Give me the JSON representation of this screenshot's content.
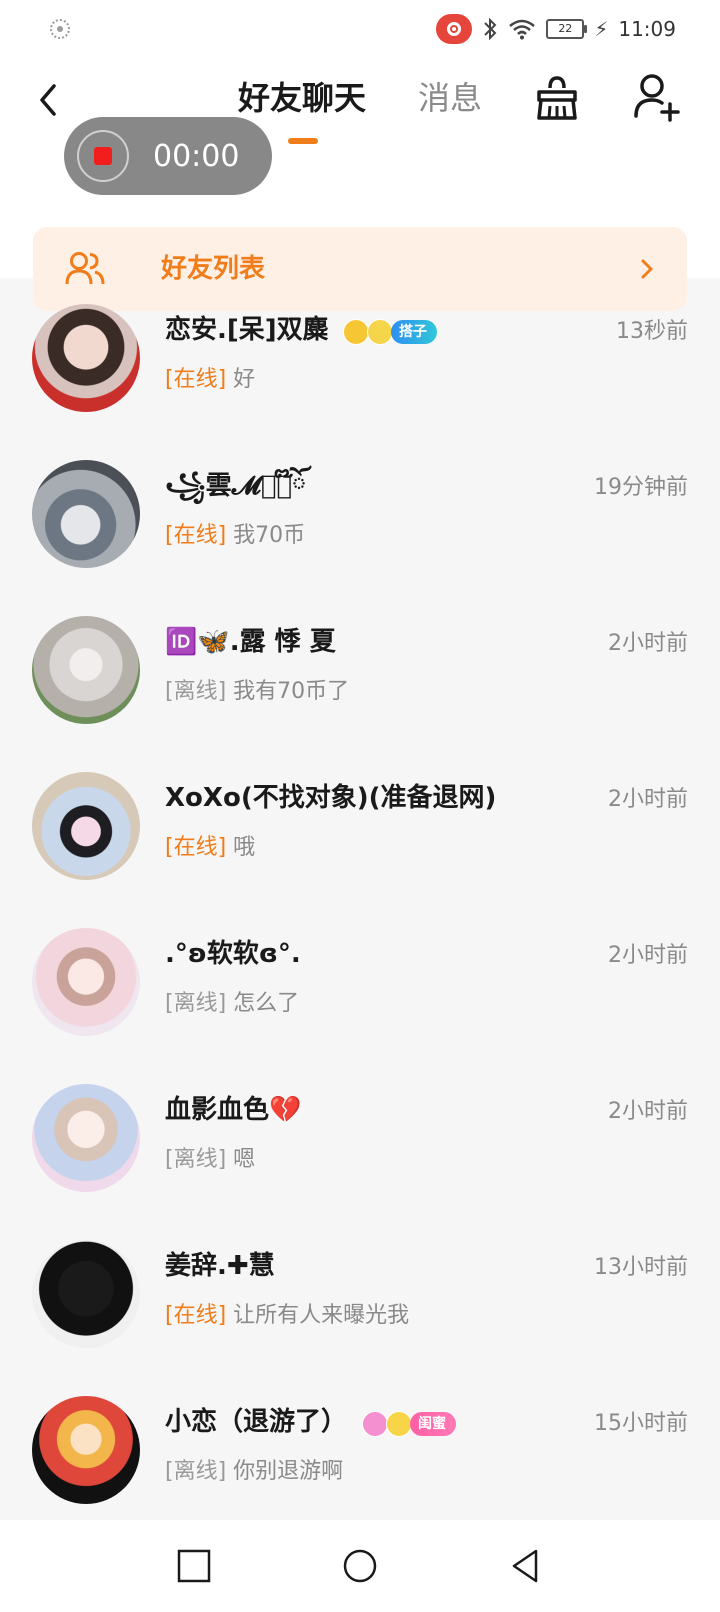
{
  "status_bar": {
    "time": "11:09",
    "battery": "22",
    "bluetooth_icon": "bluetooth-icon",
    "wifi_icon": "wifi-icon"
  },
  "header": {
    "tabs": [
      {
        "label": "好友聊天",
        "active": true
      },
      {
        "label": "消息",
        "active": false
      }
    ],
    "accent_color": "#f07d1a"
  },
  "recording": {
    "timer": "00:00"
  },
  "friend_list_banner": {
    "label": "好友列表"
  },
  "chats": [
    {
      "name": "恋安.[呆]双麋",
      "status": "[在线]",
      "online": true,
      "message": "好",
      "time": "13秒前",
      "badge": "搭子"
    },
    {
      "name": "꧁雲𝓜ꦿ゚໊ོ",
      "status": "[在线]",
      "online": true,
      "message": "我70币",
      "time": "19分钟前"
    },
    {
      "name": "🆔🦋.露  悸 夏",
      "status": "[离线]",
      "online": false,
      "message": "我有70币了",
      "time": "2小时前"
    },
    {
      "name": "XoXo(不找对象)(准备退网)",
      "status": "[在线]",
      "online": true,
      "message": "哦",
      "time": "2小时前"
    },
    {
      "name": ".°ʚ软软ɞ°.",
      "status": "[离线]",
      "online": false,
      "message": "怎么了",
      "time": "2小时前"
    },
    {
      "name": "血影血色💔",
      "status": "[离线]",
      "online": false,
      "message": "嗯",
      "time": "2小时前"
    },
    {
      "name": "姜辞.✚慧",
      "status": "[在线]",
      "online": true,
      "message": "让所有人来曝光我",
      "time": "13小时前"
    },
    {
      "name": "小恋（退游了）",
      "status": "[离线]",
      "online": false,
      "message": "你别退游啊",
      "time": "15小时前",
      "badge": "闺蜜"
    }
  ]
}
